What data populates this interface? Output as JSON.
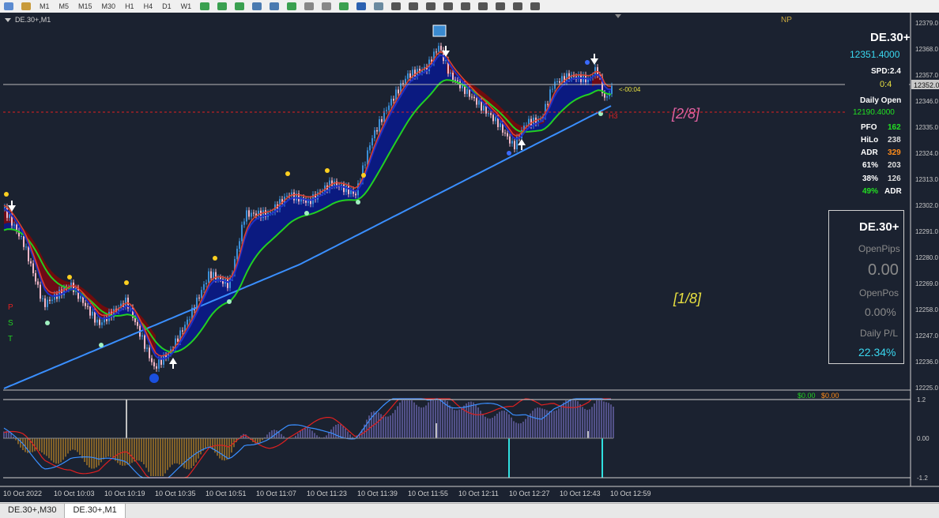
{
  "toolbar": {
    "timeframes": [
      "M1",
      "M5",
      "M15",
      "M30",
      "H1",
      "H4",
      "D1",
      "W1"
    ]
  },
  "chart": {
    "symbol_label": "DE.30+,M1",
    "np_label": "NP",
    "levels": {
      "level_2_8": "[2/8]",
      "level_1_8": "[1/8]"
    },
    "pst": [
      "P",
      "S",
      "T"
    ],
    "h3_label": "H3",
    "countdown": "<-00:04",
    "indicator_values": {
      "left": "$0.00",
      "right": "$0.00"
    },
    "price_axis": [
      "12379.0",
      "12368.0",
      "12357.0",
      "12352.0",
      "12346.0",
      "12335.0",
      "12324.0",
      "12313.0",
      "12302.0",
      "12291.0",
      "12280.0",
      "12269.0",
      "12258.0",
      "12247.0",
      "12236.0",
      "12225.0"
    ],
    "current_price_tag": "12352.0",
    "osc_axis": [
      "1.2",
      "0.00",
      "-1.2"
    ],
    "time_axis": [
      "10 Oct 2022",
      "10 Oct 10:03",
      "10 Oct 10:19",
      "10 Oct 10:35",
      "10 Oct 10:51",
      "10 Oct 11:07",
      "10 Oct 11:23",
      "10 Oct 11:39",
      "10 Oct 11:55",
      "10 Oct 12:11",
      "10 Oct 12:27",
      "10 Oct 12:43",
      "10 Oct 12:59"
    ],
    "colors": {
      "bg": "#1b2230",
      "bull": "#3a8fd8",
      "bear": "#f4b8c8",
      "fast_ma": "#2030c8",
      "slow_ma": "#22d022",
      "long_ma": "#3a8fff",
      "red_fill": "#7a0a0a",
      "navy_fill": "#0a1a8a"
    }
  },
  "info_panel": {
    "symbol": "DE.30+",
    "price": "12351.4000",
    "spread": "SPD:2.4",
    "ratio": "0:4",
    "daily_open_label": "Daily Open",
    "daily_open_value": "12190.4000",
    "stats": [
      {
        "label": "PFO",
        "value": "162",
        "color": "#22e022"
      },
      {
        "label": "HiLo",
        "value": "238",
        "color": "#dddddd"
      },
      {
        "label": "ADR",
        "value": "329",
        "color": "#ff8c1a"
      },
      {
        "label": "61%",
        "value": "203",
        "color": "#dddddd"
      },
      {
        "label": "38%",
        "value": "126",
        "color": "#dddddd"
      }
    ],
    "adr_pct": "49%",
    "adr_label": "ADR"
  },
  "account_panel": {
    "symbol": "DE.30+",
    "open_pips_label": "OpenPips",
    "open_pips_value": "0.00",
    "open_pos_label": "OpenPos",
    "open_pos_value": "0.00%",
    "daily_pl_label": "Daily P/L",
    "daily_pl_value": "22.34%"
  },
  "tabs": [
    "DE.30+,M30",
    "DE.30+,M1"
  ]
}
